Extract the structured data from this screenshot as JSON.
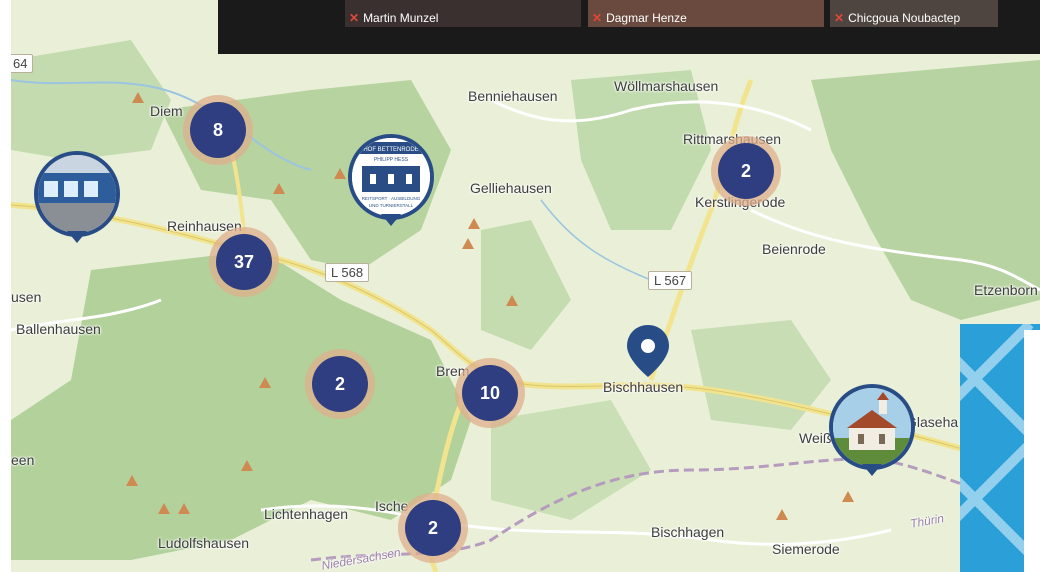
{
  "video_call": {
    "participants": [
      {
        "name": "Martin Munzel",
        "muted": true
      },
      {
        "name": "Dagmar Henze",
        "muted": true
      },
      {
        "name": "Chicgoua Noubactep",
        "muted": true
      }
    ]
  },
  "map": {
    "places": {
      "diem": "Diem",
      "benniehausen": "Benniehausen",
      "woellmarshausen": "Wöllmarshausen",
      "rittmarshausen": "Rittmarshausen",
      "kerstlingerode": "Kerstlingerode",
      "gelliehausen": "Gelliehausen",
      "reinhausen": "Reinhausen",
      "beienrode": "Beienrode",
      "etzenborn": "Etzenborn",
      "usen": "usen",
      "ballenhausen": "Ballenhausen",
      "bremke": "Brem",
      "bischhausen": "Bischhausen",
      "weissenborn": "Weiß",
      "glasehausen": "Glaseha",
      "een": "een",
      "lichtenhagen": "Lichtenhagen",
      "ischenrode": "Ische",
      "bischhagen": "Bischhagen",
      "siemerode": "Siemerode",
      "ludolfshausen": "Ludolfshausen",
      "niedersachsen": "Niedersachsen",
      "thueringen": "Thürin"
    },
    "route_labels": {
      "l568": "L 568",
      "l567": "L 567",
      "r64": "64"
    },
    "clusters": [
      {
        "id": "diemarden",
        "count": "8"
      },
      {
        "id": "reinhausen",
        "count": "37"
      },
      {
        "id": "forest",
        "count": "2"
      },
      {
        "id": "bremke",
        "count": "10"
      },
      {
        "id": "rittmarshausen",
        "count": "2"
      },
      {
        "id": "ischenrode",
        "count": "2"
      }
    ],
    "photo_markers": [
      {
        "id": "shop",
        "icon": "storefront-photo"
      },
      {
        "id": "riding",
        "icon": "riding-stable-logo",
        "lines": [
          "HOF BETTENRODE",
          "PHILIPP HESS",
          "REITSPORT · AUSBILDUNG",
          "UND TURNIERSTALL"
        ]
      },
      {
        "id": "chapel",
        "icon": "chapel-photo"
      }
    ],
    "pin": {
      "id": "bischhausen",
      "icon": "location-pin-icon"
    }
  },
  "colors": {
    "cluster": "#2e3e80",
    "cluster_halo": "#deaf8c",
    "marker_ring": "#284d86",
    "forest": "#b5d29e",
    "banner": "#2a9fd8"
  }
}
